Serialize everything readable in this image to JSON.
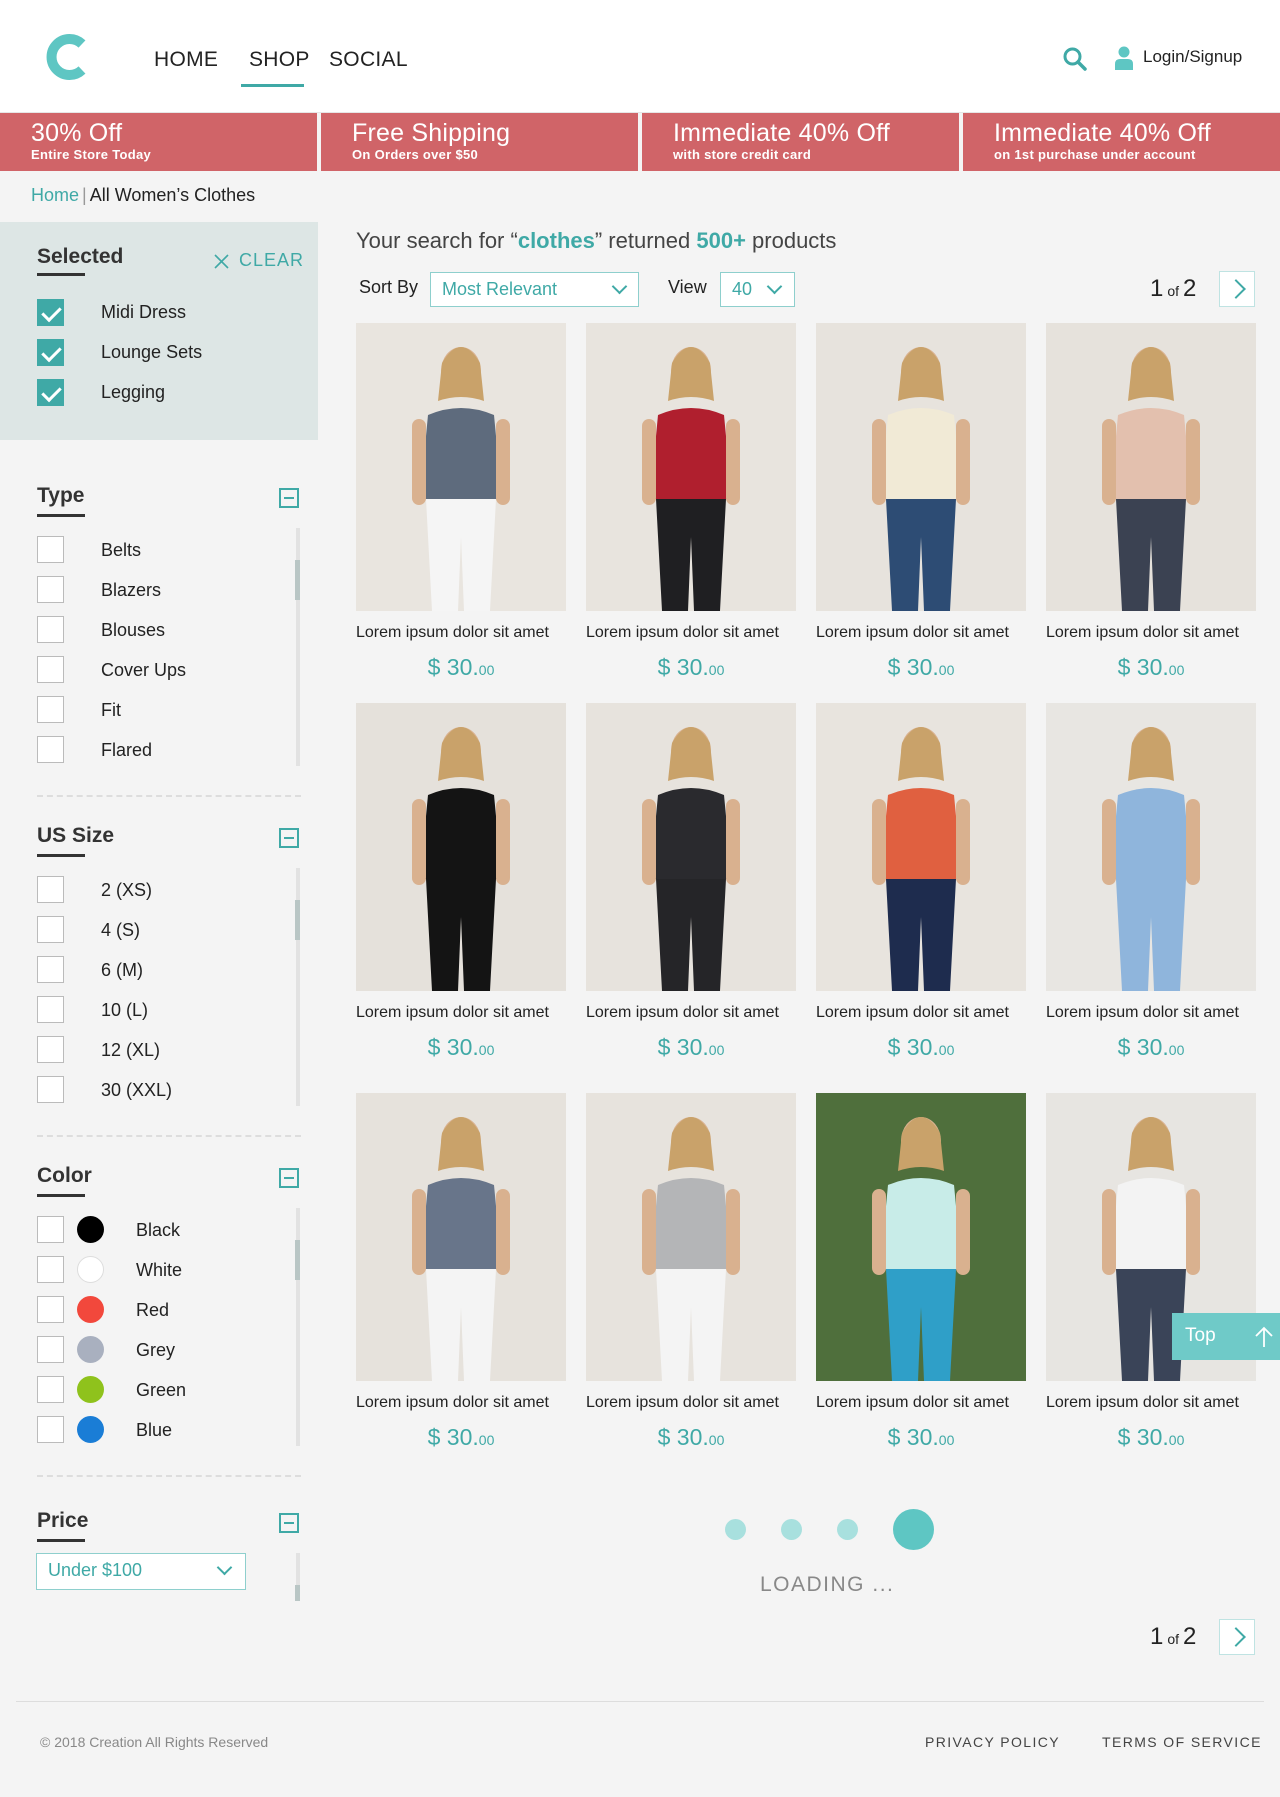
{
  "brand": {
    "logo_letter": "C",
    "accent": "#3fa9a6",
    "promo_color": "#d06468"
  },
  "nav": {
    "items": [
      "HOME",
      "SHOP",
      "SOCIAL"
    ],
    "active": "SHOP"
  },
  "header": {
    "login_label": "Login/Signup",
    "icons": [
      "search-icon",
      "user-icon"
    ]
  },
  "promos": [
    {
      "title": "30% Off",
      "sub": "Entire Store Today"
    },
    {
      "title": "Free Shipping",
      "sub": "On Orders over $50"
    },
    {
      "title": "Immediate 40% Off",
      "sub": "with store credit card"
    },
    {
      "title": "Immediate 40% Off",
      "sub": "on 1st purchase under account"
    }
  ],
  "breadcrumb": {
    "home": "Home",
    "separator": "|",
    "current": "All Women’s Clothes"
  },
  "selected": {
    "heading": "Selected",
    "clear_label": "CLEAR",
    "items": [
      "Midi Dress",
      "Lounge Sets",
      "Legging"
    ]
  },
  "filters": {
    "type": {
      "heading": "Type",
      "options": [
        "Belts",
        "Blazers",
        "Blouses",
        "Cover Ups",
        "Fit",
        "Flared"
      ]
    },
    "size": {
      "heading": "US Size",
      "options": [
        "2 (XS)",
        "4 (S)",
        "6 (M)",
        "10 (L)",
        "12 (XL)",
        "30 (XXL)"
      ]
    },
    "color": {
      "heading": "Color",
      "options": [
        {
          "label": "Black",
          "hex": "#000000"
        },
        {
          "label": "White",
          "hex": "#ffffff"
        },
        {
          "label": "Red",
          "hex": "#f2483c"
        },
        {
          "label": "Grey",
          "hex": "#a9b0bf"
        },
        {
          "label": "Green",
          "hex": "#8fc21c"
        },
        {
          "label": "Blue",
          "hex": "#1a7dd6"
        }
      ]
    },
    "price": {
      "heading": "Price",
      "selected": "Under $100"
    }
  },
  "results": {
    "prefix": "Your search for “",
    "query": "clothes",
    "middle": "” returned ",
    "count": "500+",
    "suffix": " products"
  },
  "sort": {
    "label": "Sort By",
    "selected": "Most Relevant"
  },
  "view": {
    "label": "View",
    "selected": "40"
  },
  "pagination": {
    "current": "1",
    "of": "of",
    "total": "2"
  },
  "products": [
    {
      "name": "Lorem ipsum dolor sit amet",
      "price_main": "$ 30.",
      "price_cents": "00",
      "palette": [
        "#e9e5df",
        "#5e6b7d",
        "#f5f5f5"
      ]
    },
    {
      "name": "Lorem ipsum dolor sit amet",
      "price_main": "$ 30.",
      "price_cents": "00",
      "palette": [
        "#e8e4de",
        "#b01f2e",
        "#1f1f22"
      ]
    },
    {
      "name": "Lorem ipsum dolor sit amet",
      "price_main": "$ 30.",
      "price_cents": "00",
      "palette": [
        "#e7e3dd",
        "#f1ead6",
        "#2d4c74"
      ]
    },
    {
      "name": "Lorem ipsum dolor sit amet",
      "price_main": "$ 30.",
      "price_cents": "00",
      "palette": [
        "#e6e2dc",
        "#e3c0ae",
        "#3b4252"
      ]
    },
    {
      "name": "Lorem ipsum dolor sit amet",
      "price_main": "$ 30.",
      "price_cents": "00",
      "palette": [
        "#e5e1db",
        "#141414",
        "#141414"
      ]
    },
    {
      "name": "Lorem ipsum dolor sit amet",
      "price_main": "$ 30.",
      "price_cents": "00",
      "palette": [
        "#e7e3dd",
        "#2a2a2e",
        "#252528"
      ]
    },
    {
      "name": "Lorem ipsum dolor sit amet",
      "price_main": "$ 30.",
      "price_cents": "00",
      "palette": [
        "#e8e4de",
        "#e06040",
        "#1e2c4e"
      ]
    },
    {
      "name": "Lorem ipsum dolor sit amet",
      "price_main": "$ 30.",
      "price_cents": "00",
      "palette": [
        "#e8e6e2",
        "#8fb5dc",
        "#8fb5dc"
      ]
    },
    {
      "name": "Lorem ipsum dolor sit amet",
      "price_main": "$ 30.",
      "price_cents": "00",
      "palette": [
        "#e6e2dc",
        "#68758a",
        "#f4f4f4"
      ]
    },
    {
      "name": "Lorem ipsum dolor sit amet",
      "price_main": "$ 30.",
      "price_cents": "00",
      "palette": [
        "#e7e3dd",
        "#b4b5b7",
        "#f4f4f4"
      ]
    },
    {
      "name": "Lorem ipsum dolor sit amet",
      "price_main": "$ 30.",
      "price_cents": "00",
      "palette": [
        "#4f6f3c",
        "#c8ece8",
        "#2f9fc8"
      ]
    },
    {
      "name": "Lorem ipsum dolor sit amet",
      "price_main": "$ 30.",
      "price_cents": "00",
      "palette": [
        "#e7e5e1",
        "#f3f3f3",
        "#3a4458"
      ]
    }
  ],
  "top_button": {
    "label": "Top"
  },
  "loading": {
    "label": "LOADING ..."
  },
  "footer": {
    "copyright": "© 2018 Creation All Rights Reserved",
    "links": [
      "PRIVACY POLICY",
      "TERMS OF SERVICE"
    ]
  }
}
